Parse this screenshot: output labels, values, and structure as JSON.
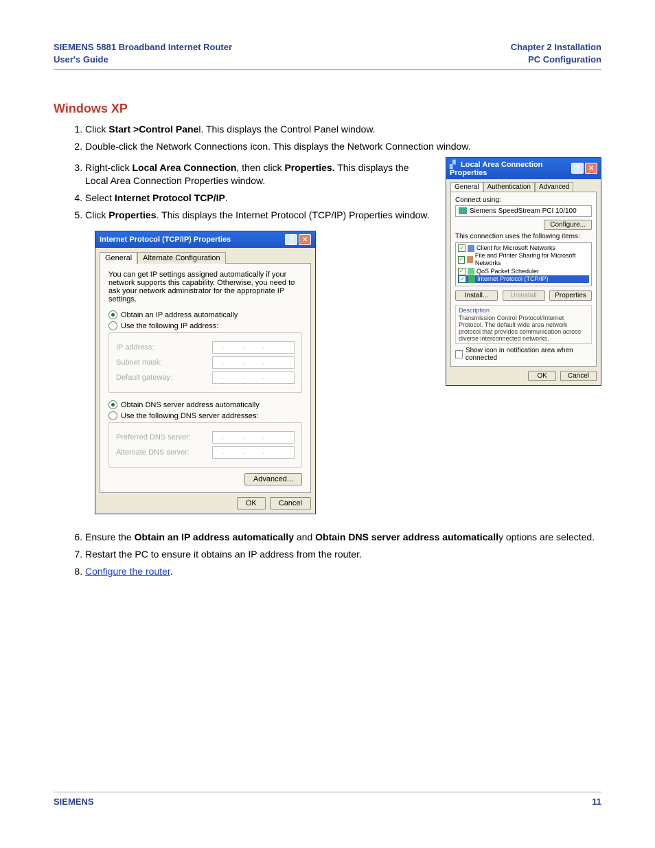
{
  "header": {
    "left_line1": "SIEMENS 5881 Broadband Internet Router",
    "left_line2": "User's Guide",
    "right_line1": "Chapter 2  Installation",
    "right_line2": "PC Configuration"
  },
  "section_title": "Windows XP",
  "steps": {
    "s1_pre": "Click ",
    "s1_bold": "Start >Control Pane",
    "s1_post": "l. This displays the Control Panel window.",
    "s2": "Double-click the Network Connections icon. This displays the Network Connection window.",
    "s3_pre": "Right-click ",
    "s3_b1": "Local Area Connection",
    "s3_mid": ", then click ",
    "s3_b2": "Properties.",
    "s3_post": " This displays the Local Area Connection Properties window.",
    "s4_pre": "Select ",
    "s4_bold": "Internet Protocol TCP/IP",
    "s4_post": ".",
    "s5_pre": "Click ",
    "s5_bold": "Properties",
    "s5_post": ". This displays the Internet Protocol (TCP/IP) Properties window.",
    "s6_pre": "Ensure the ",
    "s6_b1": "Obtain an IP address automatically",
    "s6_mid": " and ",
    "s6_b2": "Obtain DNS server address automaticall",
    "s6_post": "y options are selected.",
    "s7": "Restart the PC to ensure it obtains an IP address from the router.",
    "s8_link": "Configure the router",
    "s8_post": "."
  },
  "dlg1": {
    "title": "Internet Protocol (TCP/IP) Properties",
    "tab_general": "General",
    "tab_alt": "Alternate Configuration",
    "intro": "You can get IP settings assigned automatically if your network supports this capability. Otherwise, you need to ask your network administrator for the appropriate IP settings.",
    "r1": "Obtain an IP address automatically",
    "r2": "Use the following IP address:",
    "f_ip": "IP address:",
    "f_mask": "Subnet mask:",
    "f_gw": "Default gateway:",
    "r3": "Obtain DNS server address automatically",
    "r4": "Use the following DNS server addresses:",
    "f_pdns": "Preferred DNS server:",
    "f_adns": "Alternate DNS server:",
    "btn_adv": "Advanced...",
    "btn_ok": "OK",
    "btn_cancel": "Cancel"
  },
  "dlg2": {
    "title": "Local Area Connection Properties",
    "tab_general": "General",
    "tab_auth": "Authentication",
    "tab_adv": "Advanced",
    "connect_using": "Connect using:",
    "nic": "Siemens SpeedStream PCI 10/100",
    "btn_configure": "Configure...",
    "uses": "This connection uses the following items:",
    "it1": "Client for Microsoft Networks",
    "it2": "File and Printer Sharing for Microsoft Networks",
    "it3": "QoS Packet Scheduler",
    "it4": "Internet Protocol (TCP/IP)",
    "btn_install": "Install...",
    "btn_uninstall": "Uninstall",
    "btn_props": "Properties",
    "desc_h": "Description",
    "desc": "Transmission Control Protocol/Internet Protocol. The default wide area network protocol that provides communication across diverse interconnected networks.",
    "show_icon": "Show icon in notification area when connected",
    "btn_ok": "OK",
    "btn_cancel": "Cancel"
  },
  "footer": {
    "left": "SIEMENS",
    "right": "11"
  }
}
